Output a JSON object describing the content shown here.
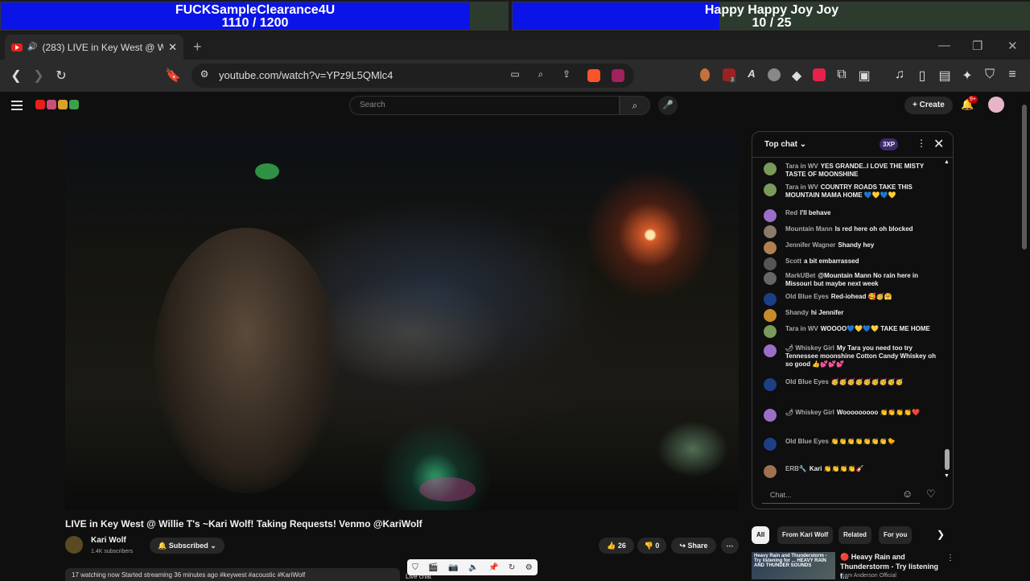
{
  "goals": [
    {
      "name": "FUCKSampleClearance4U",
      "progress": "1110 / 1200",
      "fraction": 0.925
    },
    {
      "name": "Happy Happy Joy Joy",
      "progress": "10 / 25",
      "fraction": 0.4
    }
  ],
  "browser": {
    "tab_title": "(283) LIVE in Key West @ Wil",
    "url": "youtube.com/watch?v=YPz9L5QMlc4",
    "extension_badge": "3"
  },
  "yt": {
    "search_placeholder": "Search",
    "create_label": "Create",
    "notif_count": "9+"
  },
  "video": {
    "title": "LIVE in Key West @ Willie T's ~Kari Wolf! Taking Requests! Venmo @KariWolf",
    "channel": "Kari Wolf",
    "subscribers": "1.4K subscribers",
    "subscribe_label": "Subscribed",
    "likes": "26",
    "dislikes": "0",
    "share_label": "Share",
    "description_preview": "17 watching now  Started streaming 36 minutes ago  #keywest #acoustic #KariWolf"
  },
  "chat": {
    "header": "Top chat",
    "points": "3XP",
    "input_placeholder": "Chat...",
    "messages": [
      {
        "author": "Tara in WV",
        "text": "YES GRANDE..I LOVE THE MISTY TASTE OF MOONSHINE",
        "color": "#7a9a5a"
      },
      {
        "author": "Tara in WV",
        "text": "COUNTRY ROADS TAKE THIS MOUNTAIN MAMA HOME 💙💛💙💛",
        "color": "#7a9a5a"
      },
      {
        "author": "Red",
        "text": "I'll behave",
        "color": "#9b6fc9"
      },
      {
        "author": "Mountain Mann",
        "text": "Is red here oh oh blocked",
        "color": "#8a7a6a"
      },
      {
        "author": "Jennifer Wagner",
        "text": "Shandy hey",
        "color": "#b08050"
      },
      {
        "author": "Scott",
        "text": "a bit embarrassed",
        "color": "#555555"
      },
      {
        "author": "MarkUBet",
        "text": "@Mountain Mann No rain here in Missouri but maybe next week",
        "color": "#666666"
      },
      {
        "author": "Old Blue Eyes",
        "text": "Red-iohead 🥰🥳🤗",
        "color": "#1d3f86"
      },
      {
        "author": "Shandy",
        "text": "hi Jennifer",
        "color": "#c98b2a"
      },
      {
        "author": "Tara in WV",
        "text": "WOOOO💙💛💙💛 TAKE ME HOME",
        "color": "#7a9a5a"
      },
      {
        "author": "🌶 Whiskey Girl",
        "text": "My Tara you need too try Tennessee moonshine Cotton Candy Whiskey oh so good 👍💕💕💕",
        "color": "#9b6fc9"
      },
      {
        "author": "Old Blue Eyes",
        "text": "🥳🥳🥳🥳🥳🥳🥳🥳🥳",
        "color": "#1d3f86"
      },
      {
        "author": "🌶 Whiskey Girl",
        "text": "Wooooooooo 👏👏👏👏❤️",
        "color": "#9b6fc9"
      },
      {
        "author": "Old Blue Eyes",
        "text": "👏👏👏👏👏👏👏🐤",
        "color": "#1d3f86"
      },
      {
        "author": "ERB🔧",
        "text": "Kari 👏👏👏👏🎸",
        "color": "#a07050"
      }
    ]
  },
  "chips": [
    "All",
    "From Kari Wolf",
    "Related",
    "For you"
  ],
  "recommended": {
    "thumb_text": "Heavy Rain and Thunderstorm - Try listening for ... HEAVY RAIN AND THUNDER SOUNDS",
    "title": "🔴 Heavy Rain and Thunderstorm - Try listening f...",
    "channel": "Liam Anderson Official"
  },
  "overlay": {
    "live_chat_label": "Live chat"
  }
}
